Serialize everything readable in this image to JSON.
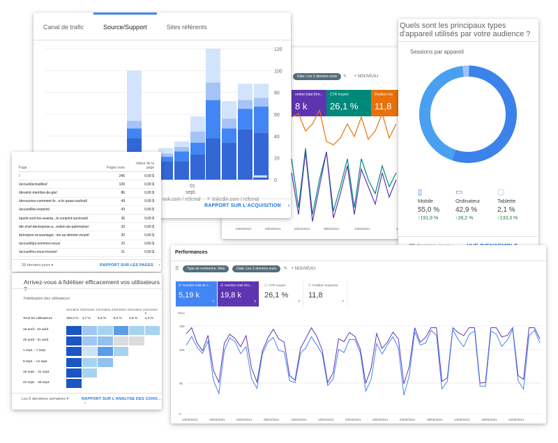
{
  "acq": {
    "tabs": [
      "Canal de trafic",
      "Source/Support",
      "Sites référents"
    ],
    "y_ticks": [
      "120",
      "100",
      "80",
      "60",
      "40",
      "20",
      "0"
    ],
    "x_day": "01",
    "x_month": "sept.",
    "legend_facebook": "ook.com / referral",
    "legend_linkedin": "linkedin.com / referral",
    "report_link": "RAPPORT SUR L'ACQUISITION",
    "colors": {
      "dark": "#3367d6",
      "mid": "#4285f4",
      "light": "#a5c3f7",
      "pale": "#d2e3fc"
    },
    "bar_stacks": [
      [
        38,
        9,
        7,
        46
      ],
      [
        4,
        2,
        2,
        8
      ],
      [
        17,
        4,
        3,
        5
      ],
      [
        17,
        9,
        4,
        5
      ],
      [
        23,
        11,
        10,
        14
      ],
      [
        38,
        35,
        16,
        31
      ],
      [
        34,
        13,
        9,
        16
      ],
      [
        46,
        19,
        8,
        15
      ],
      [
        43,
        24,
        8,
        13
      ],
      [
        38,
        23,
        6,
        12
      ],
      [
        2,
        0,
        0,
        2
      ]
    ],
    "bar_x": [
      182,
      205,
      227,
      250,
      272,
      295,
      318,
      341,
      364
    ]
  },
  "gsc": {
    "chips": [
      "Date: Les 3 derniers mois"
    ],
    "add": "NOUVEAU",
    "metrics": [
      {
        "label": "ombre total d'im...",
        "value": "8 k",
        "color": "#5e35b1"
      },
      {
        "label": "CTR moyen",
        "value": "26,1 %",
        "color": "#00897b"
      },
      {
        "label": "Position mo",
        "value": "11,8",
        "color": "#e8710a"
      }
    ],
    "x_labels": [
      "24/03/2021",
      "29/03/2021",
      "03/04/2021",
      "08/04/2021",
      "13/04/2021",
      "1"
    ],
    "series_colors": [
      "#e8710a",
      "#00897b",
      "#5e35b1"
    ]
  },
  "pages": {
    "header_page": "Page",
    "header_views": "Pages vues",
    "header_value": "Valeur de la page",
    "rows": [
      {
        "page": "/",
        "views": "246",
        "value": "0,00 $"
      },
      {
        "page": "/accueil/actualites/",
        "views": "139",
        "value": "0,00 $"
      },
      {
        "page": "/devenir-membre-du-gie/",
        "views": "86",
        "value": "0,00 $"
      },
      {
        "page": "/decouvrez-comment-fo...e-le-quasi-usufruit/",
        "views": "49",
        "value": "0,00 $"
      },
      {
        "page": "/accueil/les-experts/",
        "views": "43",
        "value": "0,00 $"
      },
      {
        "page": "/quels-sont-les-avanta...le-conjoint-survivant/",
        "views": "36",
        "value": "0,00 $"
      },
      {
        "page": "/de-chef-dentreprise-a...estion-de-patrimoine/",
        "views": "33",
        "value": "0,00 $"
      },
      {
        "page": "/principes-et-avantage...ion-au-dernier-vivant/",
        "views": "30",
        "value": "0,00 $"
      },
      {
        "page": "/accueil/qui-sommes-nous/",
        "views": "23",
        "value": "0,00 $"
      },
      {
        "page": "/accueil/ou-nous-trouver/",
        "views": "21",
        "value": "0,00 $"
      }
    ],
    "period": "28 derniers jours",
    "report_link": "RAPPORT SUR LES PAGES"
  },
  "cohort": {
    "question": "Arrivez-vous à fidéliser efficacement vos utilisateurs ?",
    "title": "Fidélisation des utilisateurs",
    "weeks": [
      "Semaine 0",
      "Semaine 1",
      "Semaine 2",
      "Semaine 3",
      "Semaine 4",
      "Semaine 5"
    ],
    "all_label": "Tous les utilisateurs",
    "all_values": [
      "100,0 %",
      "4,7 %",
      "5,9 %",
      "5,0 %",
      "2,8 %",
      "4,3 %"
    ],
    "rows": [
      {
        "label": "18 août - 24 août",
        "cells": 6
      },
      {
        "label": "25 août - 31 août",
        "cells": 5
      },
      {
        "label": "1 sept. - 7 sept.",
        "cells": 4
      },
      {
        "label": "8 sept. - 14 sept.",
        "cells": 3
      },
      {
        "label": "15 sept. - 21 sept.",
        "cells": 2
      },
      {
        "label": "22 sept. - 28 sept.",
        "cells": 1
      }
    ],
    "period": "Les 6 dernières semaines",
    "report_link": "RAPPORT SUR L'ANALYSE DES COHO..."
  },
  "devices": {
    "question": "Quels sont les principaux types d'appareil utilisés par votre audience ?",
    "title": "Sessions par appareil",
    "items": [
      {
        "name": "Mobile",
        "share": "55,0 %",
        "change": "191,9 %",
        "icon": "mobile-icon",
        "color": "#1a73e8",
        "fraction": 0.55
      },
      {
        "name": "Ordinateur",
        "share": "42,9 %",
        "change": "28,2 %",
        "icon": "desktop-icon",
        "color": "#4285f4",
        "fraction": 0.429
      },
      {
        "name": "Tablette",
        "share": "2,1 %",
        "change": "133,3 %",
        "icon": "tablet-icon",
        "color": "#a1c2fa",
        "fraction": 0.021
      }
    ],
    "up_color": "#188038",
    "period": "28 derniers jours",
    "overview_link": "VUE D'ENSEMBLE – ..."
  },
  "perf": {
    "title": "Performances",
    "chips": [
      "Type de recherche: Web",
      "Date: Les 3 derniers mois"
    ],
    "add": "NOUVEAU",
    "metrics": [
      {
        "label": "Nombre total de c...",
        "value": "5,19 k",
        "checked": true,
        "color": "#4285f4"
      },
      {
        "label": "Nombre total d'im...",
        "value": "19,8 k",
        "checked": true,
        "color": "#5e35b1"
      },
      {
        "label": "CTR moyen",
        "value": "26,1 %",
        "checked": false,
        "color": "#ffffff"
      },
      {
        "label": "Position moyenne",
        "value": "11,8",
        "checked": false,
        "color": "#ffffff"
      }
    ],
    "y_axis_title": "Clics",
    "y_ticks": [
      "150",
      "100",
      "50",
      "0"
    ],
    "x_labels": [
      "24/03/2021",
      "29/03/2021",
      "03/04/2021",
      "08/04/2021",
      "13/04/2021",
      "18/04/2021",
      "23/04/2021",
      "28/04/2021",
      "03/05/2021",
      "08/05/2021",
      "13/05/2021",
      "18/05/2021",
      "23/05/2021"
    ],
    "series_colors": [
      "#4285f4",
      "#5e35b1"
    ]
  }
}
